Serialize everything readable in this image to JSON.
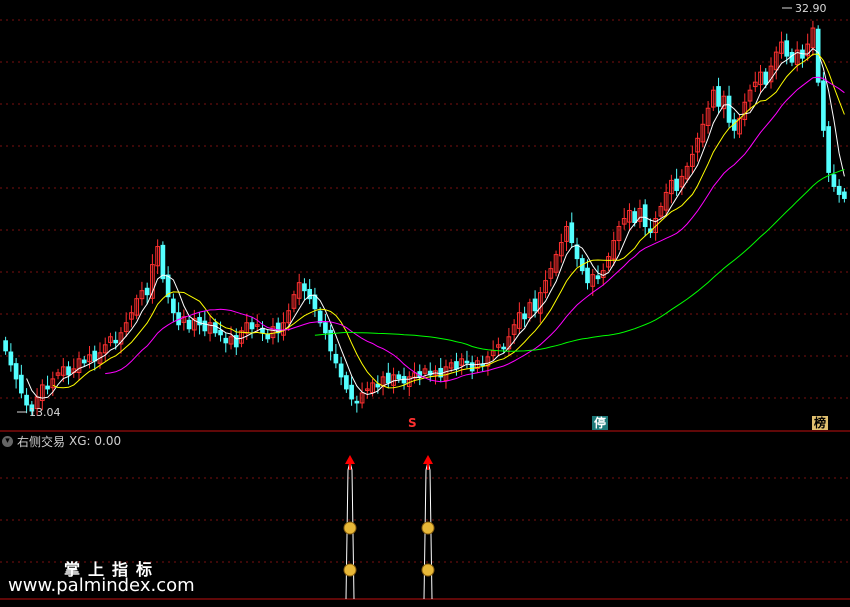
{
  "indicator": {
    "name": "右侧交易",
    "value_label": "XG: 0.00"
  },
  "price_labels": {
    "max": "32.90",
    "min": "13.04"
  },
  "markers": {
    "s": "S",
    "ting": "停",
    "bang": "榜"
  },
  "watermark": {
    "cn": "掌上指标",
    "url": "www.palmindex.com"
  },
  "chart_data": {
    "type": "candlestick",
    "y_range": [
      12.5,
      33.3
    ],
    "up_color": "#ff3030",
    "down_color": "#54ffff",
    "ma_colors": {
      "ma5": "#ffffff",
      "ma10": "#ffff00",
      "ma20": "#ff00ff",
      "ma60": "#00ff00"
    },
    "closes": [
      16.2,
      15.5,
      14.8,
      14.1,
      13.5,
      13.2,
      13.9,
      14.5,
      14.3,
      14.8,
      15.1,
      15.4,
      15.0,
      15.3,
      15.8,
      15.6,
      16.0,
      15.7,
      16.1,
      16.5,
      16.9,
      16.6,
      17.1,
      17.6,
      18.1,
      18.8,
      19.2,
      19.0,
      20.5,
      21.4,
      19.8,
      18.9,
      18.1,
      17.5,
      17.9,
      17.3,
      17.8,
      17.5,
      17.2,
      17.6,
      17.1,
      17.0,
      16.6,
      16.9,
      16.4,
      17.2,
      17.6,
      17.3,
      17.5,
      17.1,
      16.8,
      17.4,
      17.1,
      17.6,
      18.2,
      19.0,
      19.6,
      19.2,
      18.8,
      18.3,
      17.6,
      17.1,
      16.2,
      15.6,
      14.9,
      14.3,
      13.8,
      13.6,
      14.1,
      14.3,
      14.6,
      14.4,
      14.9,
      14.6,
      15.0,
      14.8,
      14.6,
      14.9,
      15.1,
      14.9,
      15.3,
      15.0,
      15.2,
      14.9,
      15.4,
      15.6,
      15.3,
      15.8,
      15.6,
      15.2,
      15.7,
      15.5,
      15.9,
      16.2,
      16.5,
      16.3,
      16.9,
      17.5,
      18.1,
      17.8,
      18.6,
      18.2,
      19.1,
      19.7,
      20.3,
      21.0,
      21.6,
      22.4,
      21.6,
      20.8,
      20.2,
      19.6,
      20.0,
      19.8,
      20.2,
      20.9,
      21.7,
      22.4,
      22.8,
      23.2,
      22.6,
      23.3,
      22.4,
      22.1,
      22.8,
      23.4,
      24.1,
      24.7,
      24.2,
      24.9,
      25.4,
      26.0,
      26.8,
      27.5,
      28.3,
      29.2,
      28.4,
      28.9,
      27.6,
      27.2,
      27.8,
      28.6,
      29.2,
      29.6,
      30.1,
      29.5,
      30.4,
      31.1,
      31.6,
      30.9,
      30.6,
      31.2,
      30.8,
      31.5,
      32.3,
      29.6,
      27.2,
      25.1,
      24.4,
      24.0,
      23.8
    ]
  }
}
